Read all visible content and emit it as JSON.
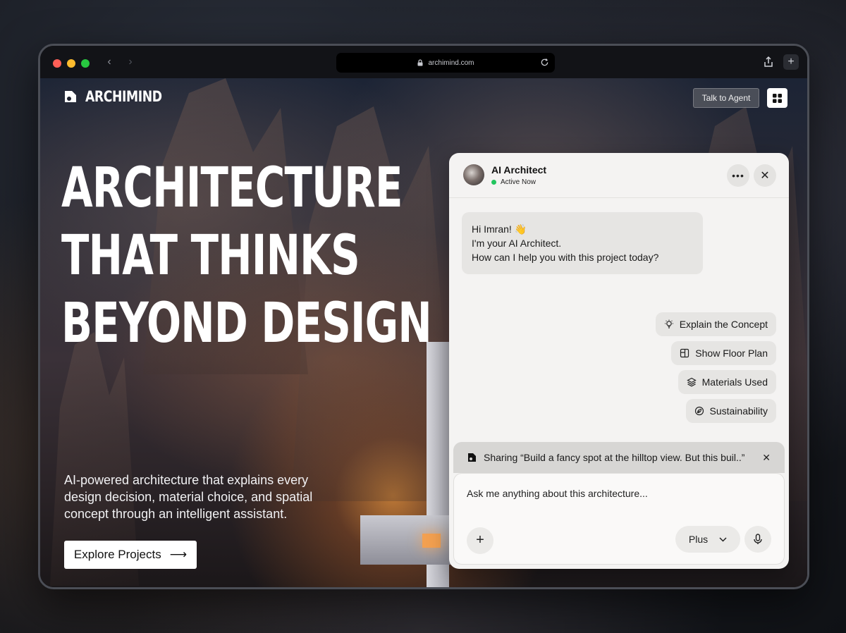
{
  "browser": {
    "url": "archimind.com",
    "new_tab_label": "+"
  },
  "site": {
    "brand": "ARCHIMIND",
    "talk_to_agent_label": "Talk to Agent"
  },
  "hero": {
    "headline_lines": [
      "ARCHITECTURE",
      "THAT THINKS",
      "BEYOND DESIGN"
    ],
    "subtext": "AI-powered architecture that explains every design decision, material choice, and spatial concept through an intelligent assistant.",
    "cta_label": "Explore Projects",
    "cta_arrow": "⟶"
  },
  "chat": {
    "agent_name": "AI Architect",
    "agent_status": "Active Now",
    "more_label": "•••",
    "close_label": "✕",
    "greeting_lines": [
      "Hi Imran! 👋",
      "I'm your AI Architect.",
      "How can I help you with this project today?"
    ],
    "suggestions": [
      {
        "label": "Explain the Concept",
        "icon": "lightbulb-icon"
      },
      {
        "label": "Show Floor Plan",
        "icon": "floor-plan-icon"
      },
      {
        "label": "Materials Used",
        "icon": "layers-icon"
      },
      {
        "label": "Sustainability",
        "icon": "leaf-icon"
      }
    ],
    "sharing_text": "Sharing “Build a fancy spot at the hilltop view. But this buil..”",
    "sharing_close": "✕",
    "input_placeholder": "Ask me anything about this architecture...",
    "add_label": "+",
    "plan_label": "Plus",
    "plan_chevron": "⌄"
  },
  "colors": {
    "status_active": "#22c55e",
    "chat_bg": "#f4f3f2",
    "glow": "#f3a050"
  }
}
